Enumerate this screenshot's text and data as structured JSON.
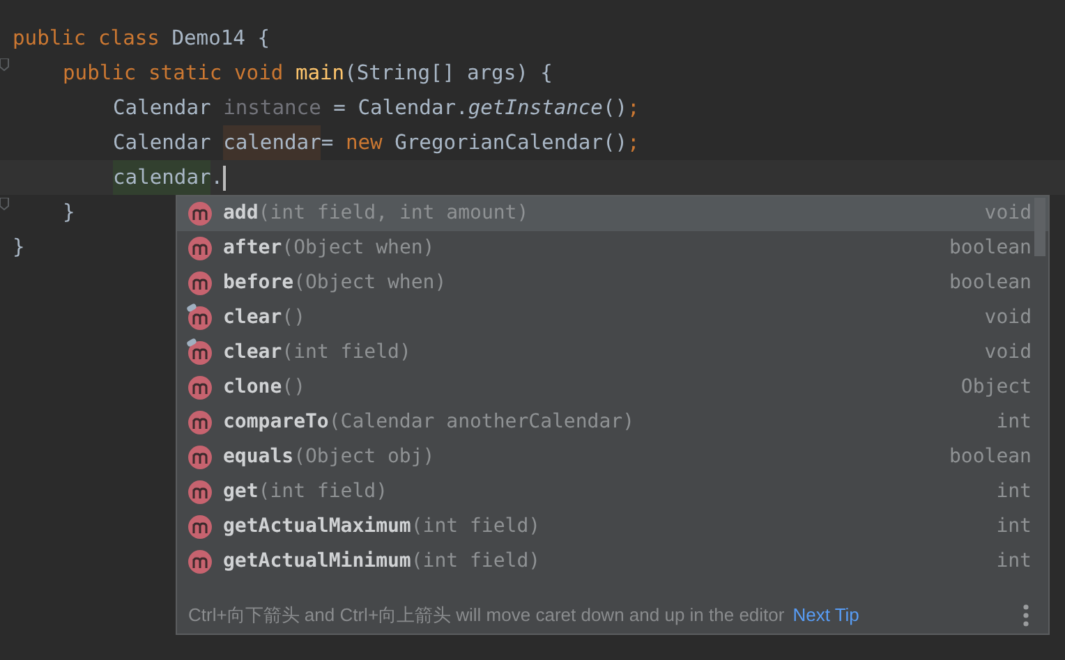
{
  "editor": {
    "lines": [
      {
        "fold": false,
        "caret": false,
        "tokens": [
          {
            "text": "public class ",
            "kind": "keyword"
          },
          {
            "text": "Demo14 {",
            "kind": "plain"
          }
        ],
        "children": [
          {
            "fold": true,
            "caret": false,
            "tokens": [
              {
                "text": "public static void ",
                "kind": "keyword"
              },
              {
                "text": "main",
                "kind": "method-decl"
              },
              {
                "text": "(String[] args) {",
                "kind": "plain"
              }
            ],
            "children": [
              {
                "fold": false,
                "caret": false,
                "tokens": [
                  {
                    "text": "Calendar ",
                    "kind": "plain"
                  },
                  {
                    "text": "instance",
                    "kind": "unused"
                  },
                  {
                    "text": " = Calendar.",
                    "kind": "plain"
                  },
                  {
                    "text": "getInstance",
                    "kind": "static-call"
                  },
                  {
                    "text": "()",
                    "kind": "plain"
                  },
                  {
                    "text": ";",
                    "kind": "keyword"
                  }
                ]
              },
              {
                "fold": false,
                "caret": false,
                "tokens": [
                  {
                    "text": "Calendar ",
                    "kind": "plain"
                  },
                  {
                    "text": "calendar",
                    "kind": "decl-highlight"
                  },
                  {
                    "text": "= ",
                    "kind": "plain"
                  },
                  {
                    "text": "new ",
                    "kind": "keyword"
                  },
                  {
                    "text": "GregorianCalendar()",
                    "kind": "plain"
                  },
                  {
                    "text": ";",
                    "kind": "keyword"
                  }
                ]
              },
              {
                "fold": false,
                "caret": true,
                "tokens": [
                  {
                    "text": "calendar",
                    "kind": "usage-highlight"
                  },
                  {
                    "text": ".",
                    "kind": "plain"
                  }
                ]
              }
            ]
          },
          {
            "fold": true,
            "caret": false,
            "tokens": [
              {
                "text": "}",
                "kind": "plain"
              }
            ]
          }
        ]
      },
      {
        "fold": false,
        "caret": false,
        "tokens": [
          {
            "text": "}",
            "kind": "plain"
          }
        ]
      }
    ]
  },
  "completion": {
    "items": [
      {
        "name": "add",
        "params": "(int field, int amount)",
        "type": "void",
        "selected": true,
        "marked": false
      },
      {
        "name": "after",
        "params": "(Object when)",
        "type": "boolean",
        "selected": false,
        "marked": false
      },
      {
        "name": "before",
        "params": "(Object when)",
        "type": "boolean",
        "selected": false,
        "marked": false
      },
      {
        "name": "clear",
        "params": "()",
        "type": "void",
        "selected": false,
        "marked": true
      },
      {
        "name": "clear",
        "params": "(int field)",
        "type": "void",
        "selected": false,
        "marked": true
      },
      {
        "name": "clone",
        "params": "()",
        "type": "Object",
        "selected": false,
        "marked": false
      },
      {
        "name": "compareTo",
        "params": "(Calendar anotherCalendar)",
        "type": "int",
        "selected": false,
        "marked": false
      },
      {
        "name": "equals",
        "params": "(Object obj)",
        "type": "boolean",
        "selected": false,
        "marked": false
      },
      {
        "name": "get",
        "params": "(int field)",
        "type": "int",
        "selected": false,
        "marked": false
      },
      {
        "name": "getActualMaximum",
        "params": "(int field)",
        "type": "int",
        "selected": false,
        "marked": false
      },
      {
        "name": "getActualMinimum",
        "params": "(int field)",
        "type": "int",
        "selected": false,
        "marked": false
      }
    ],
    "hint": "Ctrl+向下箭头 and Ctrl+向上箭头 will move caret down and up in the editor",
    "next_tip": "Next Tip"
  }
}
